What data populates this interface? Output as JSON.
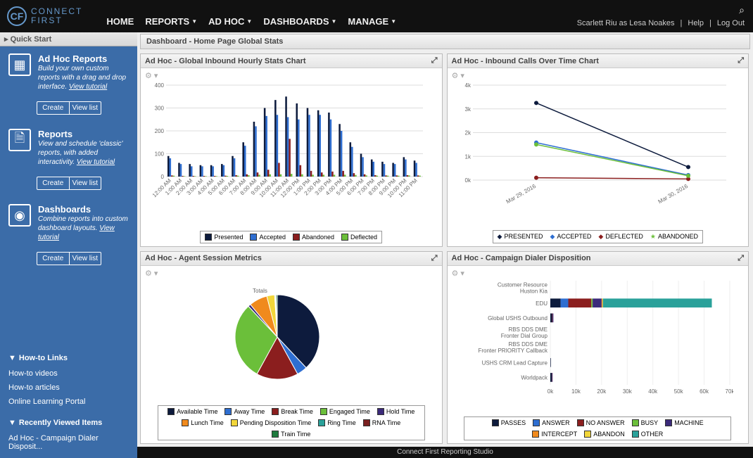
{
  "brand": {
    "line1": "CONNECT",
    "line2": "FIRST"
  },
  "nav": {
    "home": "HOME",
    "reports": "REPORTS",
    "adhoc": "AD HOC",
    "dashboards": "DASHBOARDS",
    "manage": "MANAGE"
  },
  "user": {
    "label": "Scarlett Riu as Lesa Noakes",
    "help": "Help",
    "logout": "Log Out"
  },
  "quickstart": "Quick Start",
  "sb_adhoc": {
    "title": "Ad Hoc Reports",
    "desc": "Build your own custom reports with a drag and drop interface. ",
    "link": "View tutorial"
  },
  "sb_reports": {
    "title": "Reports",
    "desc": "View and schedule 'classic' reports, with added interactivity. ",
    "link": "View tutorial"
  },
  "sb_dash": {
    "title": "Dashboards",
    "desc": "Combine reports into custom dashboard layouts. ",
    "link": "View tutorial"
  },
  "btn_create": "Create",
  "btn_view": "View list",
  "howto": {
    "hdr": "How-to Links",
    "l1": "How-to videos",
    "l2": "How-to articles",
    "l3": "Online Learning Portal"
  },
  "recent": {
    "hdr": "Recently Viewed Items",
    "l1": "Ad Hoc - Campaign Dialer Disposit..."
  },
  "breadcrumb": "Dashboard - Home Page Global Stats",
  "footer": "Connect First Reporting Studio",
  "panel1": {
    "title": "Ad Hoc - Global Inbound Hourly Stats Chart"
  },
  "panel2": {
    "title": "Ad Hoc - Inbound Calls Over Time Chart"
  },
  "panel3": {
    "title": "Ad Hoc - Agent Session Metrics",
    "pie_label": "Totals"
  },
  "panel4": {
    "title": "Ad Hoc - Campaign Dialer Disposition"
  },
  "legend1": {
    "a": "Presented",
    "b": "Accepted",
    "c": "Abandoned",
    "d": "Deflected"
  },
  "legend2": {
    "a": "PRESENTED",
    "b": "ACCEPTED",
    "c": "DEFLECTED",
    "d": "ABANDONED"
  },
  "legend3": {
    "a": "Available Time",
    "b": "Away Time",
    "c": "Break Time",
    "d": "Engaged Time",
    "e": "Hold Time",
    "f": "Lunch Time",
    "g": "Pending Disposition Time",
    "h": "Ring Time",
    "i": "RNA Time",
    "j": "Train Time"
  },
  "legend4": {
    "a": "PASSES",
    "b": "ANSWER",
    "c": "NO ANSWER",
    "d": "BUSY",
    "e": "MACHINE",
    "f": "INTERCEPT",
    "g": "ABANDON",
    "h": "OTHER"
  },
  "chart_data": [
    {
      "type": "bar",
      "title": "Global Inbound Hourly Stats",
      "ylim": [
        0,
        400
      ],
      "yticks": [
        0,
        100,
        200,
        300,
        400
      ],
      "categories": [
        "12:00 AM",
        "1:00 AM",
        "2:00 AM",
        "3:00 AM",
        "4:00 AM",
        "5:00 AM",
        "6:00 AM",
        "7:00 AM",
        "8:00 AM",
        "9:00 AM",
        "10:00 AM",
        "11:00 AM",
        "12:00 PM",
        "1:00 PM",
        "2:00 PM",
        "3:00 PM",
        "4:00 PM",
        "5:00 PM",
        "6:00 PM",
        "7:00 PM",
        "8:00 PM",
        "9:00 PM",
        "10:00 PM",
        "11:00 PM"
      ],
      "series": [
        {
          "name": "Presented",
          "color": "#0d1b3d",
          "values": [
            90,
            60,
            55,
            50,
            50,
            55,
            90,
            150,
            240,
            300,
            335,
            350,
            320,
            300,
            290,
            280,
            230,
            150,
            100,
            75,
            65,
            60,
            85,
            70
          ]
        },
        {
          "name": "Accepted",
          "color": "#2e6ed1",
          "values": [
            80,
            55,
            45,
            45,
            45,
            50,
            80,
            135,
            220,
            265,
            270,
            260,
            250,
            270,
            270,
            250,
            200,
            130,
            85,
            65,
            55,
            55,
            75,
            60
          ]
        },
        {
          "name": "Abandoned",
          "color": "#8b1e1e",
          "values": [
            5,
            3,
            3,
            3,
            3,
            4,
            6,
            10,
            18,
            30,
            60,
            165,
            50,
            25,
            18,
            22,
            25,
            15,
            10,
            6,
            5,
            5,
            6,
            5
          ]
        },
        {
          "name": "Deflected",
          "color": "#6bbf3a",
          "values": [
            4,
            2,
            2,
            2,
            2,
            3,
            4,
            6,
            8,
            10,
            10,
            12,
            10,
            8,
            8,
            8,
            8,
            7,
            5,
            4,
            4,
            4,
            5,
            4
          ]
        }
      ]
    },
    {
      "type": "line",
      "title": "Inbound Calls Over Time",
      "ylim": [
        0,
        4000
      ],
      "yticks": [
        "0k",
        "1k",
        "2k",
        "3k",
        "4k"
      ],
      "x": [
        "Mar 29, 2016",
        "Mar 30, 2016"
      ],
      "series": [
        {
          "name": "PRESENTED",
          "color": "#0d1b3d",
          "marker": "diamond",
          "values": [
            3250,
            550
          ]
        },
        {
          "name": "ACCEPTED",
          "color": "#2e6ed1",
          "marker": "diamond",
          "values": [
            1580,
            210
          ]
        },
        {
          "name": "DEFLECTED",
          "color": "#8b1e1e",
          "marker": "diamond",
          "values": [
            100,
            50
          ]
        },
        {
          "name": "ABANDONED",
          "color": "#6bbf3a",
          "marker": "star",
          "values": [
            1500,
            180
          ]
        }
      ]
    },
    {
      "type": "pie",
      "title": "Agent Session Metrics Totals",
      "slices": [
        {
          "name": "Available Time",
          "color": "#0d1b3d",
          "value": 38
        },
        {
          "name": "Away Time",
          "color": "#2e6ed1",
          "value": 4
        },
        {
          "name": "Break Time",
          "color": "#8b1e1e",
          "value": 16
        },
        {
          "name": "Engaged Time",
          "color": "#6bbf3a",
          "value": 30
        },
        {
          "name": "Hold Time",
          "color": "#3b2a7a",
          "value": 1
        },
        {
          "name": "Lunch Time",
          "color": "#f08a1d",
          "value": 7
        },
        {
          "name": "Pending Disposition Time",
          "color": "#f2d63a",
          "value": 3
        },
        {
          "name": "Ring Time",
          "color": "#2aa19a",
          "value": 0.3
        },
        {
          "name": "RNA Time",
          "color": "#7a2020",
          "value": 0.2
        },
        {
          "name": "Train Time",
          "color": "#1e7a3e",
          "value": 0.5
        }
      ]
    },
    {
      "type": "bar_stacked_h",
      "title": "Campaign Dialer Disposition",
      "xlim": [
        0,
        70000
      ],
      "xticks": [
        "0k",
        "10k",
        "20k",
        "30k",
        "40k",
        "50k",
        "60k",
        "70k"
      ],
      "categories": [
        "Customer Resource Huston Kia",
        "EDU",
        "Global USHS Outbound",
        "RBS DDS DME Fronter Dial Group",
        "RBS DDS DME Fronter PRIORITY Callback",
        "USHS CRM Lead Capture",
        "Worldpack"
      ],
      "series": [
        {
          "name": "PASSES",
          "color": "#0d1b3d",
          "values": [
            0,
            4000,
            700,
            0,
            0,
            200,
            600
          ]
        },
        {
          "name": "ANSWER",
          "color": "#2e6ed1",
          "values": [
            0,
            3000,
            0,
            0,
            0,
            0,
            0
          ]
        },
        {
          "name": "NO ANSWER",
          "color": "#8b1e1e",
          "values": [
            0,
            9000,
            200,
            0,
            0,
            0,
            100
          ]
        },
        {
          "name": "BUSY",
          "color": "#6bbf3a",
          "values": [
            0,
            500,
            0,
            0,
            0,
            0,
            0
          ]
        },
        {
          "name": "MACHINE",
          "color": "#3b2a7a",
          "values": [
            0,
            3500,
            300,
            0,
            0,
            0,
            200
          ]
        },
        {
          "name": "INTERCEPT",
          "color": "#f08a1d",
          "values": [
            0,
            300,
            0,
            0,
            0,
            0,
            0
          ]
        },
        {
          "name": "ABANDON",
          "color": "#f2d63a",
          "values": [
            0,
            200,
            0,
            0,
            0,
            0,
            0
          ]
        },
        {
          "name": "OTHER",
          "color": "#2aa19a",
          "values": [
            0,
            42500,
            0,
            0,
            0,
            0,
            0
          ]
        }
      ]
    }
  ]
}
